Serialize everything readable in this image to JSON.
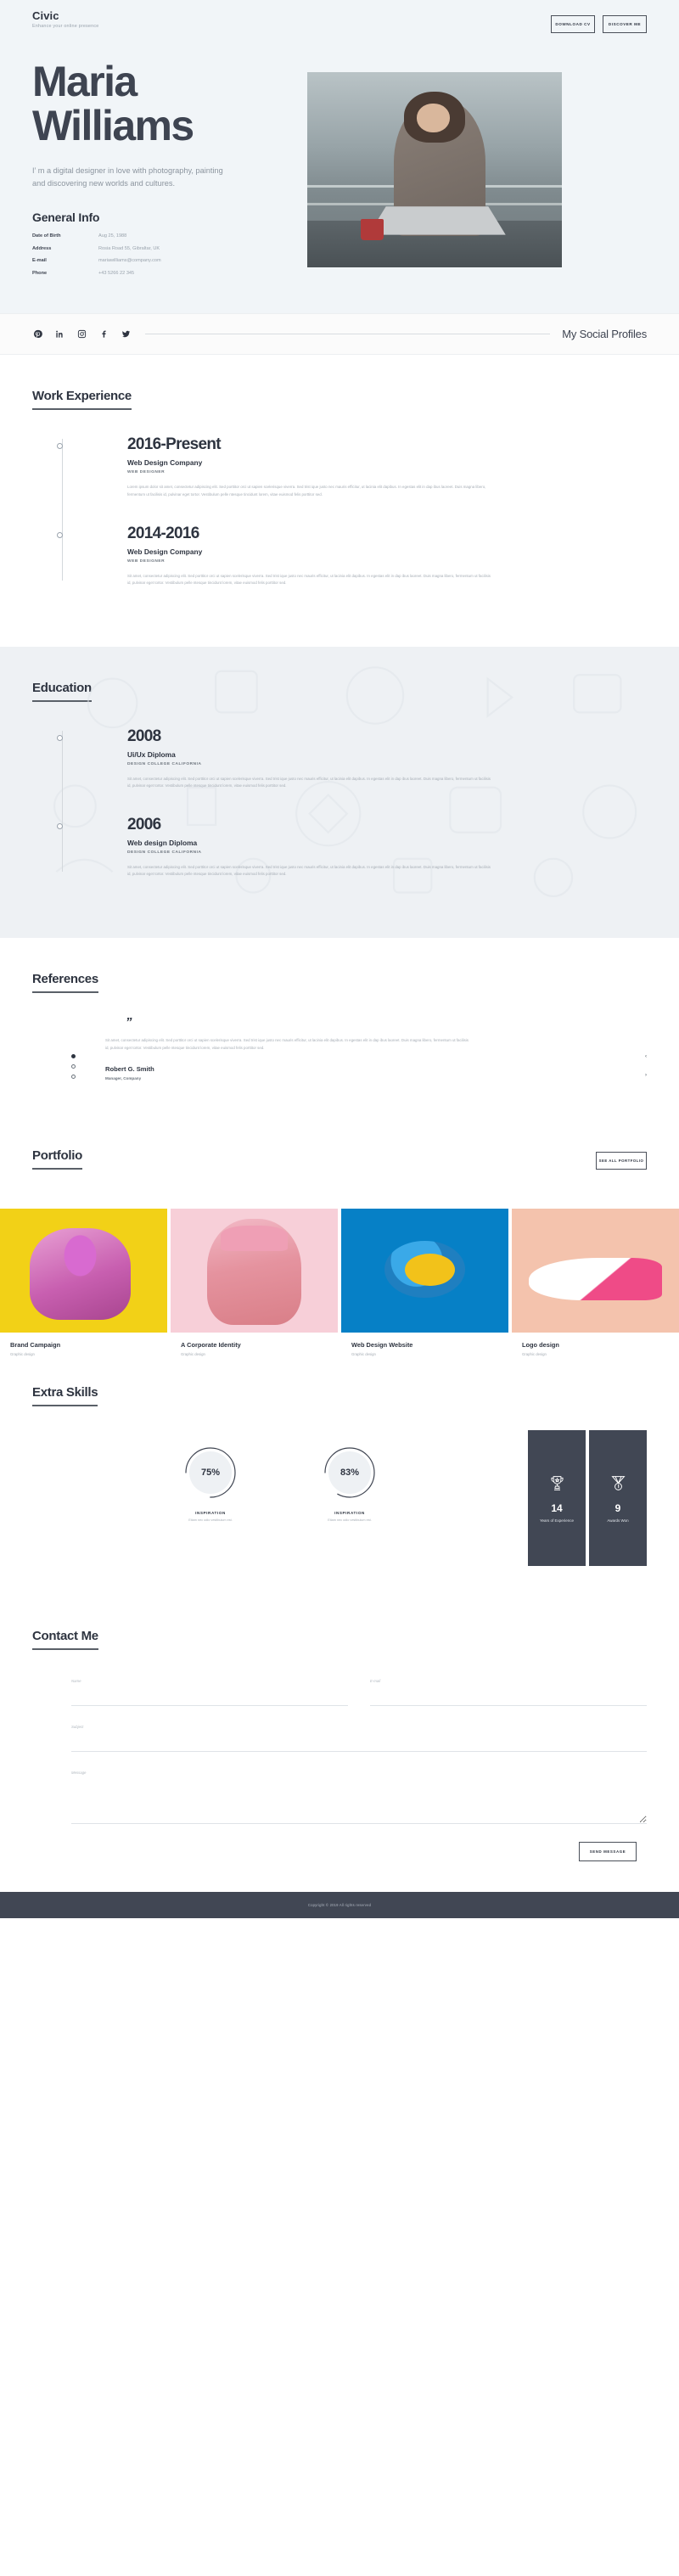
{
  "brand": {
    "name": "Civic",
    "tagline": "Enhance your online presence"
  },
  "topbar": {
    "download_label": "DOWNLOAD CV",
    "discover_label": "DISCOVER ME"
  },
  "hero": {
    "first_name": "Maria",
    "last_name": "Williams",
    "intro": "I’ m a digital designer in love with photography, painting and discovering new worlds and cultures.",
    "general_info_title": "General Info",
    "info": [
      {
        "key": "Date of Birth",
        "value": "Aug 25, 1988"
      },
      {
        "key": "Address",
        "value": "Rosia Road 55, Gibraltar, UK"
      },
      {
        "key": "E-mail",
        "value": "mariawilliams@company.com"
      },
      {
        "key": "Phone",
        "value": "+43 5266 22 345"
      }
    ]
  },
  "social": {
    "title": "My Social Profiles",
    "icons": [
      "pinterest-icon",
      "linkedin-icon",
      "instagram-icon",
      "facebook-icon",
      "twitter-icon"
    ]
  },
  "work": {
    "title": "Work Experience",
    "items": [
      {
        "year": "2016-Present",
        "org": "Web Design Company",
        "role": "WEB DESIGNER",
        "desc": "Lorem ipsum dolor sit amet, consectetur adipiscing elit. Sed porttitor orci ut sapien scelerisque viverra. Sed trist ique justo nec mauris efficitur, ut lacinia elit dapibus. In egestas elit in dap ibus laoreet. Duis magna libero, fermentum ut facilisis id, pulvinar eget tortor. Vestibulum pelle ntesque tincidunt lorem, vitae euismod felis porttitor sed."
      },
      {
        "year": "2014-2016",
        "org": "Web Design Company",
        "role": "WEB DESIGNER",
        "desc": "Sit amet, consectetur adipiscing elit. Sed porttitor orci ut sapien scelerisque viverra. Sed trist ique justo nec mauris efficitur, ut lacinia elit dapibus. In egestas elit in dap ibus laoreet. Duis magna libero, fermentum ut facilisis id, pulvinar eget tortor. Vestibulum pelle ntesque tincidunt lorem, vitae euismod felis porttitor sed."
      }
    ]
  },
  "education": {
    "title": "Education",
    "items": [
      {
        "year": "2008",
        "org": "Ui/Ux Diploma",
        "role": "DESIGN COLLEGE CALIFORNIA",
        "desc": "Sit amet, consectetur adipiscing elit. Sed porttitor orci ut sapien scelerisque viverra. Sed trist ique justo nec mauris efficitur, ut lacinia elit dapibus. In egestas elit in dap ibus laoreet. Duis magna libero, fermentum ut facilisis id, pulvinar eget tortor. Vestibulum pelle ntesque tincidunt lorem, vitae euismod felis porttitor sed."
      },
      {
        "year": "2006",
        "org": "Web design Diploma",
        "role": "DESIGN COLLEGE CALIFORNIA",
        "desc": "Sit amet, consectetur adipiscing elit. Sed porttitor orci ut sapien scelerisque viverra. Sed trist ique justo nec mauris efficitur, ut lacinia elit dapibus. In egestas elit in dap ibus laoreet. Duis magna libero, fermentum ut facilisis id, pulvinar eget tortor. Vestibulum pelle ntesque tincidunt lorem, vitae euismod felis porttitor sed."
      }
    ]
  },
  "references": {
    "title": "References",
    "quote_mark": "”",
    "text": "Sit amet, consectetur adipiscing elit. Sed porttitor orci ut sapien scelerisque viverra. Sed trist ique justo nec mauris efficitur, ut lacinia elit dapibus. In egestas elit in dap ibus laoreet. Duis magna libero, fermentum ut facilisis id, pulvinar eget tortor. Vestibulum pelle ntesque tincidunt lorem, vitae euismod felis porttitor sed.",
    "author": "Robert G. Smith",
    "author_role": "Manager, Company",
    "prev_arrow": "‹",
    "next_arrow": "›"
  },
  "portfolio": {
    "title": "Portfolio",
    "see_all_label": "SEE ALL PORTFOLIO",
    "items": [
      {
        "title": "Brand Campaign",
        "category": "Graphic design"
      },
      {
        "title": "A Corporate Identity",
        "category": "Graphic design"
      },
      {
        "title": "Web Design Website",
        "category": "Graphic design"
      },
      {
        "title": "Logo design",
        "category": "Graphic design"
      }
    ]
  },
  "skills": {
    "title": "Extra Skills",
    "dials": [
      {
        "percent": 75,
        "percent_label": "75%",
        "name": "INSPIRATION",
        "sub": "Etiam nec odio vestibulum est."
      },
      {
        "percent": 83,
        "percent_label": "83%",
        "name": "INSPIRATION",
        "sub": "Etiam nec odio vestibulum est."
      }
    ],
    "stats": [
      {
        "icon": "trophy-icon",
        "number": "14",
        "label": "Years of Experience"
      },
      {
        "icon": "medal-icon",
        "number": "9",
        "label": "Awards Won"
      }
    ]
  },
  "contact": {
    "title": "Contact Me",
    "name_label": "Name",
    "name_value": "",
    "email_label": "E-mail",
    "email_value": "",
    "subject_label": "Subject",
    "subject_value": "",
    "message_label": "Message",
    "message_value": "",
    "send_label": "SEND MESSAGE"
  },
  "footer": {
    "copyright": "Copyright © 2019 All rights reserved"
  },
  "colors": {
    "dark": "#414754",
    "tint": "#eef1f4",
    "hero_bg": "#f1f5f8",
    "muted": "#a6adb5"
  }
}
